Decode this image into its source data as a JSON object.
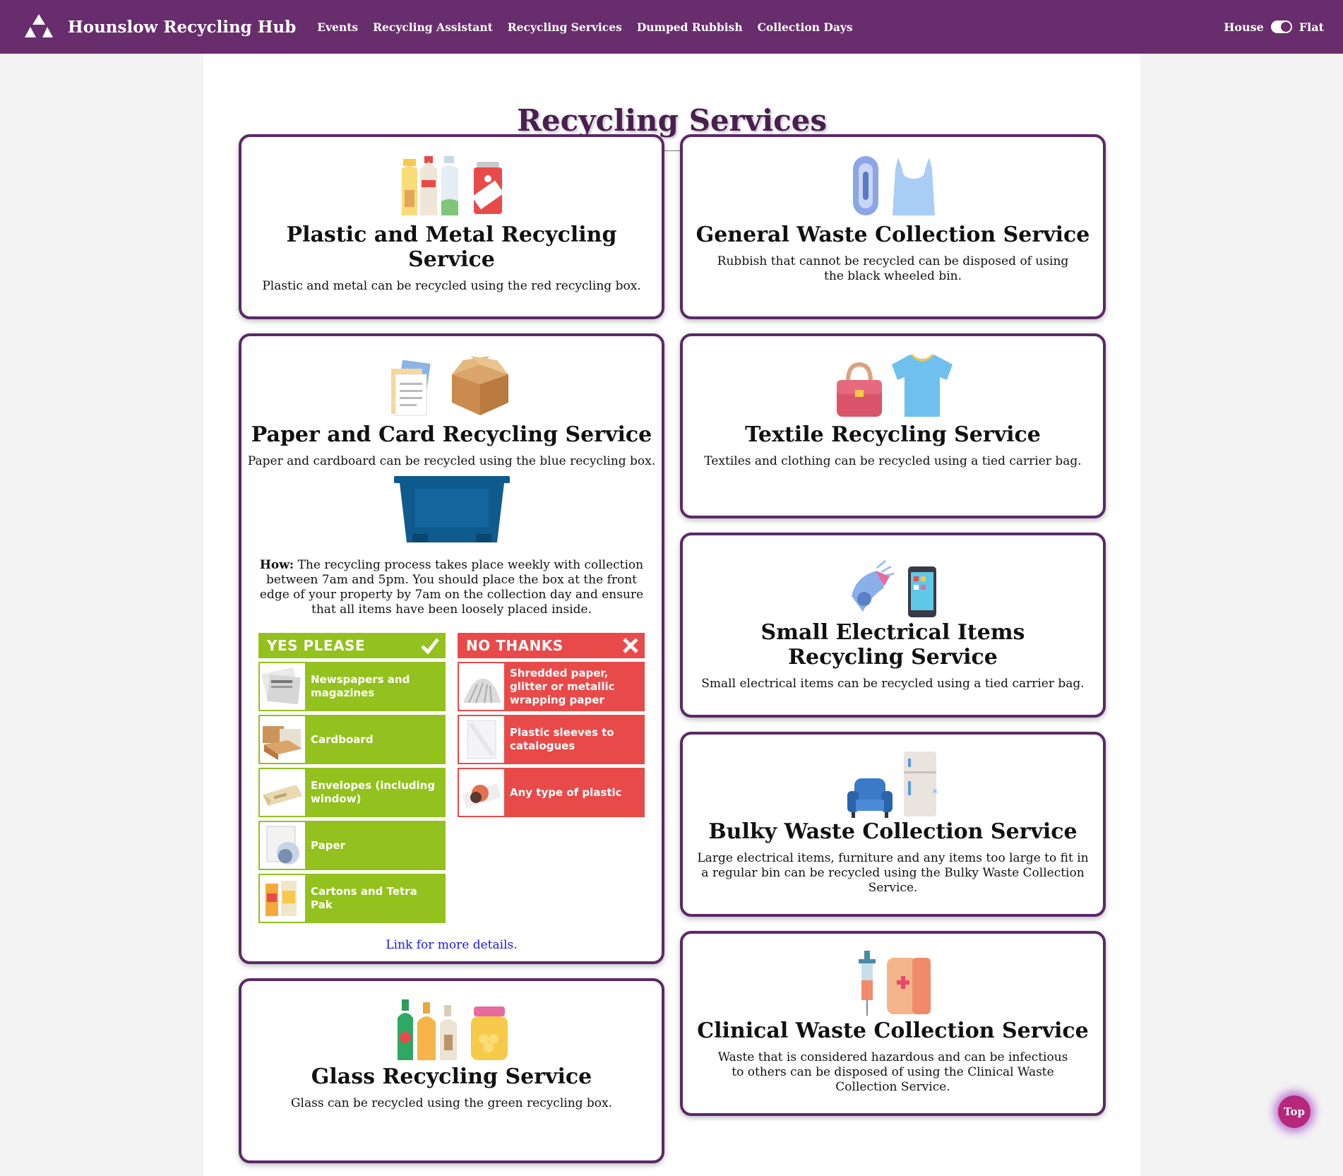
{
  "header": {
    "brand": "Hounslow Recycling Hub",
    "nav": [
      "Events",
      "Recycling Assistant",
      "Recycling Services",
      "Dumped Rubbish",
      "Collection Days"
    ],
    "toggle_left": "House",
    "toggle_right": "Flat"
  },
  "page": {
    "title": "Recycling Services"
  },
  "cards": {
    "plastic": {
      "title": "Plastic and Metal Recycling Service",
      "text": "Plastic and metal can be recycled using the red recycling box."
    },
    "general": {
      "title": "General Waste Collection Service",
      "text": "Rubbish that cannot be recycled can be disposed of using the black wheeled bin."
    },
    "paper": {
      "title": "Paper and Card Recycling Service",
      "text": "Paper and cardboard can be recycled using the blue recycling box.",
      "how_label": "How:",
      "how_text": " The recycling process takes place weekly with collection between 7am and 5pm. You should place the box at the front edge of your property by 7am on the collection day and ensure that all items have been loosely placed inside.",
      "yes_title": "YES PLEASE",
      "no_title": "NO THANKS",
      "yes_items": [
        "Newspapers and magazines",
        "Cardboard",
        "Envelopes (including window)",
        "Paper",
        "Cartons and Tetra Pak"
      ],
      "no_items": [
        "Shredded paper, glitter or metallic wrapping paper",
        "Plastic sleeves to catalogues",
        "Any type of plastic"
      ],
      "link": "Link for more details."
    },
    "textile": {
      "title": "Textile Recycling Service",
      "text": "Textiles and clothing can be recycled using a tied carrier bag."
    },
    "electrical": {
      "title": "Small Electrical Items Recycling Service",
      "text": "Small electrical items can be recycled using a tied carrier bag."
    },
    "bulky": {
      "title": "Bulky Waste Collection Service",
      "text": "Large electrical items, furniture and any items too large to fit in a regular bin can be recycled using the Bulky Waste Collection Service."
    },
    "clinical": {
      "title": "Clinical Waste Collection Service",
      "text": "Waste that is considered hazardous and can be infectious to others can be disposed of using the Clinical Waste Collection Service."
    },
    "glass": {
      "title": "Glass Recycling Service",
      "text": "Glass can be recycled using the green recycling box."
    }
  },
  "top_button": "Top",
  "colors": {
    "brand": "#672d6c",
    "yes": "#93c11d",
    "no": "#e84a4a",
    "link": "#1a1adb"
  }
}
